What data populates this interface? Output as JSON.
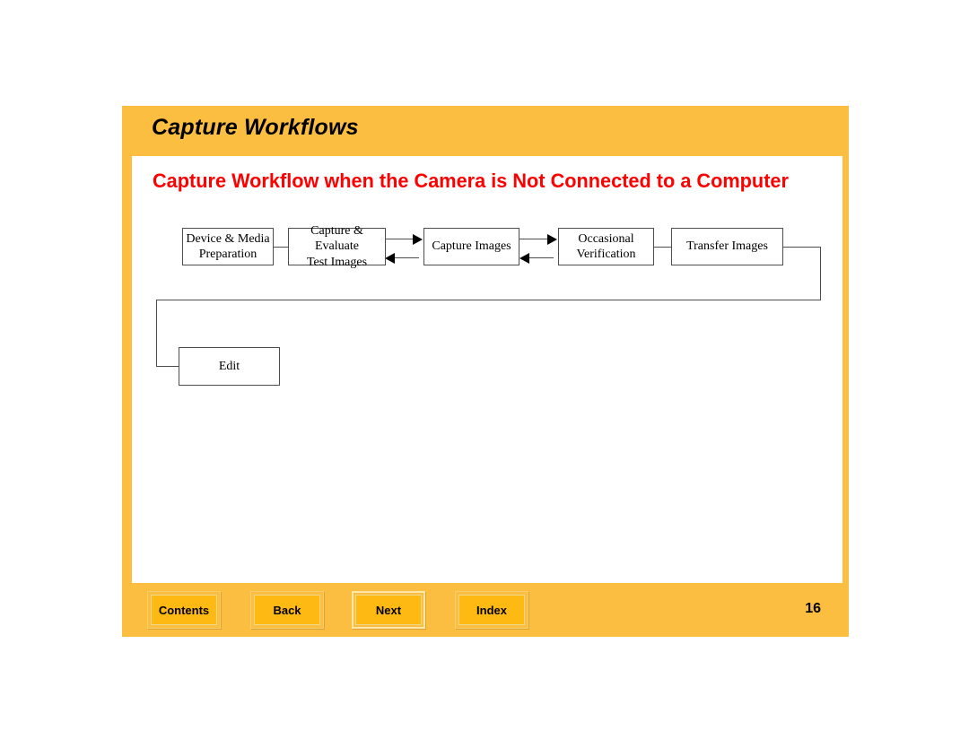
{
  "document": {
    "title": "Capture Workflows",
    "section_heading": "Capture Workflow when the Camera is Not Connected to a Computer",
    "page_number": "16"
  },
  "colors": {
    "frame_orange": "#fcbe40",
    "button_orange": "#feb913",
    "heading_red": "#ff0000",
    "content_white": "#ffffff",
    "box_border": "#4d4d4d"
  },
  "diagram": {
    "type": "flowchart",
    "boxes": [
      {
        "id": "device-media-preparation",
        "line1": "Device & Media",
        "line2": "Preparation"
      },
      {
        "id": "capture-evaluate-test-images",
        "line1": "Capture & Evaluate",
        "line2": "Test Images"
      },
      {
        "id": "capture-images",
        "line1": "Capture  Images",
        "line2": ""
      },
      {
        "id": "occasional-verification",
        "line1": "Occasional",
        "line2": "Verification"
      },
      {
        "id": "transfer-images",
        "line1": "Transfer Images",
        "line2": ""
      },
      {
        "id": "edit",
        "line1": "Edit",
        "line2": ""
      }
    ],
    "connections": [
      {
        "from": "device-media-preparation",
        "to": "capture-evaluate-test-images",
        "style": "plain"
      },
      {
        "from": "capture-evaluate-test-images",
        "to": "capture-images",
        "style": "arrow"
      },
      {
        "from": "capture-images",
        "to": "capture-evaluate-test-images",
        "style": "arrow"
      },
      {
        "from": "capture-images",
        "to": "occasional-verification",
        "style": "arrow"
      },
      {
        "from": "occasional-verification",
        "to": "capture-images",
        "style": "arrow"
      },
      {
        "from": "occasional-verification",
        "to": "transfer-images",
        "style": "plain"
      },
      {
        "from": "transfer-images",
        "to": "edit",
        "style": "plain-routed"
      }
    ]
  },
  "footer": {
    "buttons": [
      {
        "id": "contents",
        "label": "Contents",
        "selected": false
      },
      {
        "id": "back",
        "label": "Back",
        "selected": false
      },
      {
        "id": "next",
        "label": "Next",
        "selected": true
      },
      {
        "id": "index",
        "label": "Index",
        "selected": false
      }
    ]
  }
}
